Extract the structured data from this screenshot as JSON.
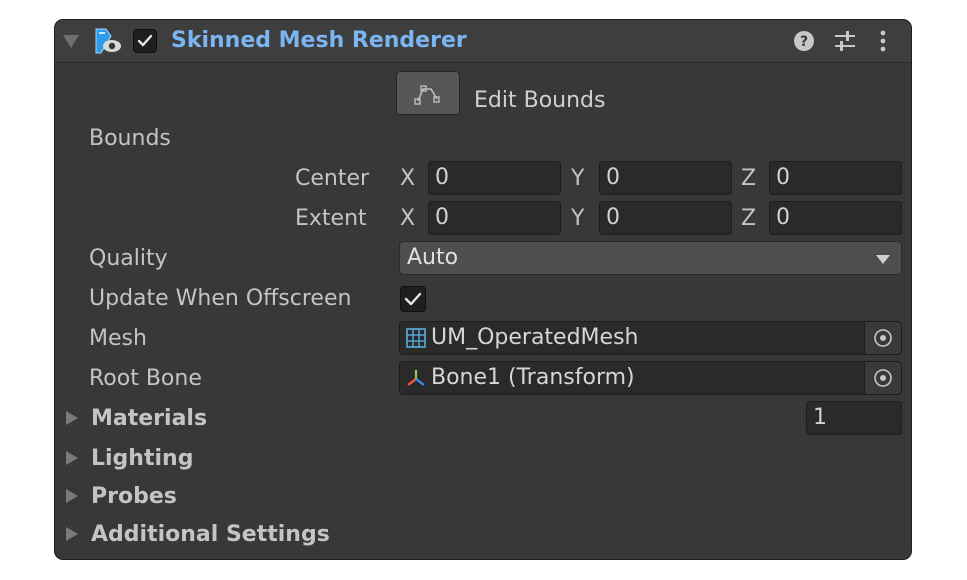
{
  "component": {
    "title": "Skinned Mesh Renderer",
    "enabled": true,
    "icons": [
      "help-icon",
      "presets-icon",
      "more-menu-icon"
    ]
  },
  "edit_bounds": {
    "label": "Edit Bounds"
  },
  "bounds": {
    "label": "Bounds",
    "center": {
      "label": "Center",
      "x_label": "X",
      "x": "0",
      "y_label": "Y",
      "y": "0",
      "z_label": "Z",
      "z": "0"
    },
    "extent": {
      "label": "Extent",
      "x_label": "X",
      "x": "0",
      "y_label": "Y",
      "y": "0",
      "z_label": "Z",
      "z": "0"
    }
  },
  "quality": {
    "label": "Quality",
    "value": "Auto"
  },
  "update_when_offscreen": {
    "label": "Update When Offscreen",
    "checked": true
  },
  "mesh": {
    "label": "Mesh",
    "value": "UM_OperatedMesh"
  },
  "root_bone": {
    "label": "Root Bone",
    "value": "Bone1 (Transform)"
  },
  "sections": [
    {
      "label": "Materials",
      "count": "1"
    },
    {
      "label": "Lighting"
    },
    {
      "label": "Probes"
    },
    {
      "label": "Additional Settings"
    }
  ],
  "colors": {
    "panel_bg": "#383838",
    "title_blue": "#7bb6f2",
    "field_bg": "#2a2a2a",
    "dropdown_bg": "#4e4e4e"
  }
}
